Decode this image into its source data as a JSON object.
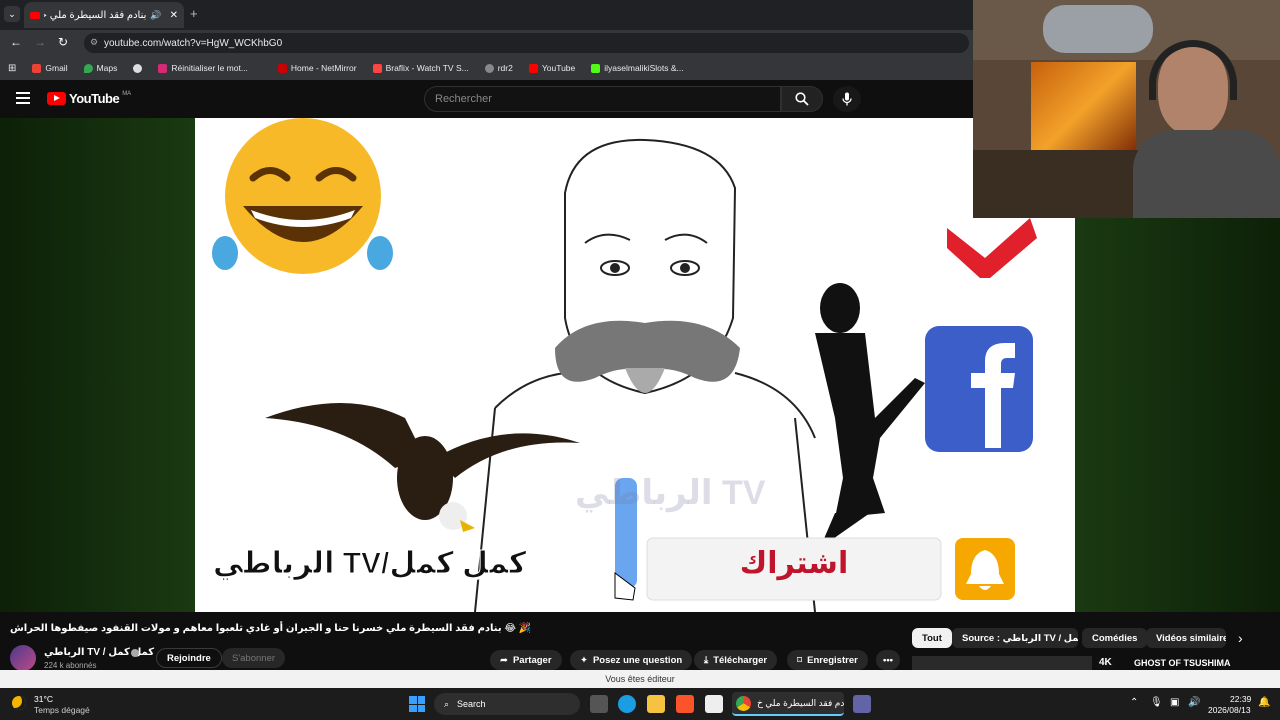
{
  "browser": {
    "tab_title": "بنادم فقد السيطرة ملي خسر",
    "url": "youtube.com/watch?v=HgW_WCKhbG0",
    "bookmarks": [
      "Gmail",
      "Maps",
      "Réinitialiser le mot...",
      "Home - NetMirror",
      "Braflix - Watch TV S...",
      "rdr2",
      "YouTube",
      "ilyaselmalikiSlots &..."
    ]
  },
  "youtube": {
    "logo_text": "YouTube",
    "region": "MA",
    "search_placeholder": "Rechercher"
  },
  "video": {
    "overlay_text": "الرباطي TV/كمل كمل",
    "watermark": "الرباطي TV",
    "subscribe_label": "اشتراك"
  },
  "info": {
    "title": "🎉 😂 بنادم فقد السيطرة ملي خسرنا حنا و الجيران أو غادي تلعبوا معاهم و مولات القنفود صيفطوها الحراش",
    "channel_name": "الرباطي TV / كمل كمل",
    "subscribers": "224 k abonnés",
    "join_label": "Rejoindre",
    "subscribe_label": "S'abonner",
    "actions": [
      "Partager",
      "Posez une question",
      "Télécharger",
      "Enregistrer"
    ],
    "filter_chips": [
      "Tout",
      "Source : الرباطي TV / كمل كمل",
      "Comédies",
      "Vidéos similaires"
    ],
    "next_video_title": "GHOST OF TSUSHIMA",
    "next_video_badge": "4K"
  },
  "editor_bar": "Vous êtes éditeur",
  "taskbar": {
    "temperature": "31°C",
    "weather": "Temps dégagé",
    "search_label": "Search",
    "active_window": "بنادم فقد السيطرة ملي خ",
    "time": "22:39",
    "date": "2026/08/13"
  }
}
